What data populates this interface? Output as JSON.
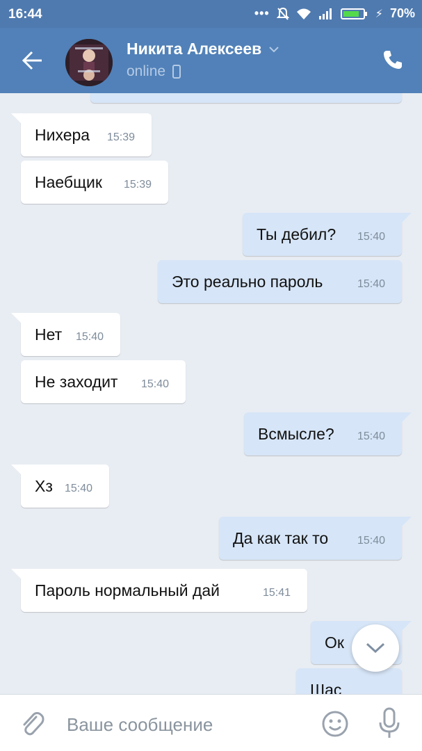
{
  "status_bar": {
    "time": "16:44",
    "battery": "70%"
  },
  "header": {
    "contact_name": "Никита Алексеев",
    "presence": "online"
  },
  "messages": [
    {
      "dir": "in",
      "text": "Нихера",
      "time": "15:39"
    },
    {
      "dir": "in",
      "text": "Наебщик",
      "time": "15:39"
    },
    {
      "dir": "out",
      "text": "Ты дебил?",
      "time": "15:40"
    },
    {
      "dir": "out",
      "text": "Это реально пароль",
      "time": "15:40"
    },
    {
      "dir": "in",
      "text": "Нет",
      "time": "15:40"
    },
    {
      "dir": "in",
      "text": "Не заходит",
      "time": "15:40"
    },
    {
      "dir": "out",
      "text": "Всмысле?",
      "time": "15:40"
    },
    {
      "dir": "in",
      "text": "Хз",
      "time": "15:40"
    },
    {
      "dir": "out",
      "text": "Да как так то",
      "time": "15:40"
    },
    {
      "dir": "in",
      "text": "Пароль нормальный дай",
      "time": "15:41"
    },
    {
      "dir": "out",
      "text": "Ок",
      "time": ""
    },
    {
      "dir": "out",
      "text": "Шас",
      "time": ""
    }
  ],
  "composer": {
    "placeholder": "Ваше сообщение"
  },
  "colors": {
    "header": "#5181b8",
    "incoming": "#ffffff",
    "outgoing": "#d6e5f7",
    "background": "#e8edf3"
  }
}
